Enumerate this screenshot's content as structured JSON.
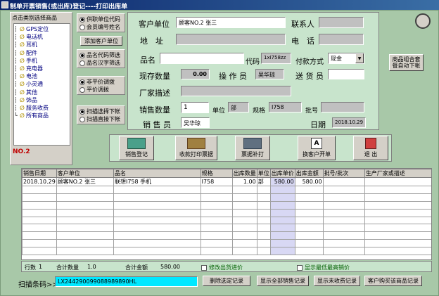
{
  "window": {
    "title": "制单开票销售(或出库)登记----打印出库单"
  },
  "tree": {
    "header": "点击类别选择商品",
    "items": [
      "GPS定位",
      "电话机",
      "耳机",
      "配件",
      "手机",
      "充电器",
      "电池",
      "小灵通",
      "其他",
      "饰品",
      "服务收费",
      "所有商品"
    ],
    "footer": "NO.2"
  },
  "options": {
    "group1": [
      "供职单位代码",
      "会员编号姓名"
    ],
    "add_customer": "添加客户单位",
    "group2": [
      "品名代码筛选",
      "品名汉字筛选"
    ],
    "group3": [
      "非平价调拨",
      "平价调拨"
    ],
    "group4": [
      "扫描选择下帐",
      "扫描直接下帐"
    ]
  },
  "form": {
    "customer_label": "客户单位",
    "customer_value": "顾客NO.2 张三",
    "contact_label": "联系人",
    "contact_value": "",
    "address_label": "地　址",
    "address_value": "",
    "phone_label": "电　话",
    "phone_value": "",
    "product_label": "品名",
    "product_value": "",
    "code_label": "代码",
    "code_value": "1xi758zz",
    "payment_label": "付款方式",
    "payment_value": "现金",
    "stock_label": "现存数量",
    "stock_value": "0.00",
    "operator_label": "操 作 员",
    "operator_value": "吴华琼",
    "delivery_label": "送 货 员",
    "delivery_value": "",
    "vendor_label": "厂家描述",
    "vendor_value": "",
    "qty_label": "销售数量",
    "qty_value": "1",
    "unit_label": "单位",
    "unit_value": "部",
    "spec_label": "规格",
    "spec_value": "I758",
    "batch_label": "批号",
    "batch_value": "",
    "seller_label": "销 售 员",
    "seller_value": "吴华琼",
    "date_label": "日期",
    "date_value": "2018.10.29"
  },
  "merge_button": "商品组合套餐自动下帐",
  "toolbar": [
    "销售登记",
    "收款打印票据",
    "票据补打",
    "换客户开单",
    "退 出"
  ],
  "table": {
    "columns": [
      "销售日期",
      "客户单位",
      "品名",
      "规格",
      "出库数量",
      "单位",
      "出库单价",
      "出库金额",
      "批号/批次",
      "生产厂家或描述"
    ],
    "rows": [
      [
        "2018.10.29",
        "顾客NO.2 张三",
        "联想I758 手机",
        "I758",
        "1.00",
        "部",
        "580.00",
        "580.00",
        "",
        ""
      ]
    ]
  },
  "summary": {
    "rows_label": "行数",
    "rows_value": "1",
    "qty_label": "合计数量",
    "qty_value": "1.0",
    "amount_label": "合计金额",
    "amount_value": "580.00",
    "check1": "修改出货进价",
    "check2": "显示最低最高销价"
  },
  "scan": {
    "label": "扫描条码>>",
    "value": "LX244290099088989890HL"
  },
  "bottom_buttons": [
    "删除选定记录",
    "显示全部销售记录",
    "显示未收费记录",
    "客户购买该商品记录"
  ],
  "colors": {
    "background": "#a8c8a8",
    "form_panel": "#c8e4cc",
    "tree_panel": "#d4d0c8"
  }
}
